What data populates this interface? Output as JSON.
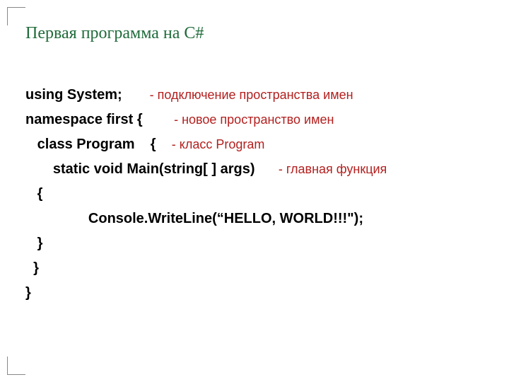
{
  "title": "Первая программа на C#",
  "lines": [
    {
      "code": "using System;       ",
      "comment": "- подключение пространства имен"
    },
    {
      "code": "namespace first {        ",
      "comment": "- новое пространство имен"
    },
    {
      "code": "   class Program    {    ",
      "comment": "- класс Program"
    },
    {
      "code": "       static void Main(string[ ] args)      ",
      "comment": "- главная функция"
    },
    {
      "code": "   {",
      "comment": ""
    },
    {
      "code": "                Console.WriteLine(“HELLO, WORLD!!!\");",
      "comment": ""
    },
    {
      "code": "   }",
      "comment": ""
    },
    {
      "code": "  }",
      "comment": ""
    },
    {
      "code": "}",
      "comment": ""
    }
  ]
}
